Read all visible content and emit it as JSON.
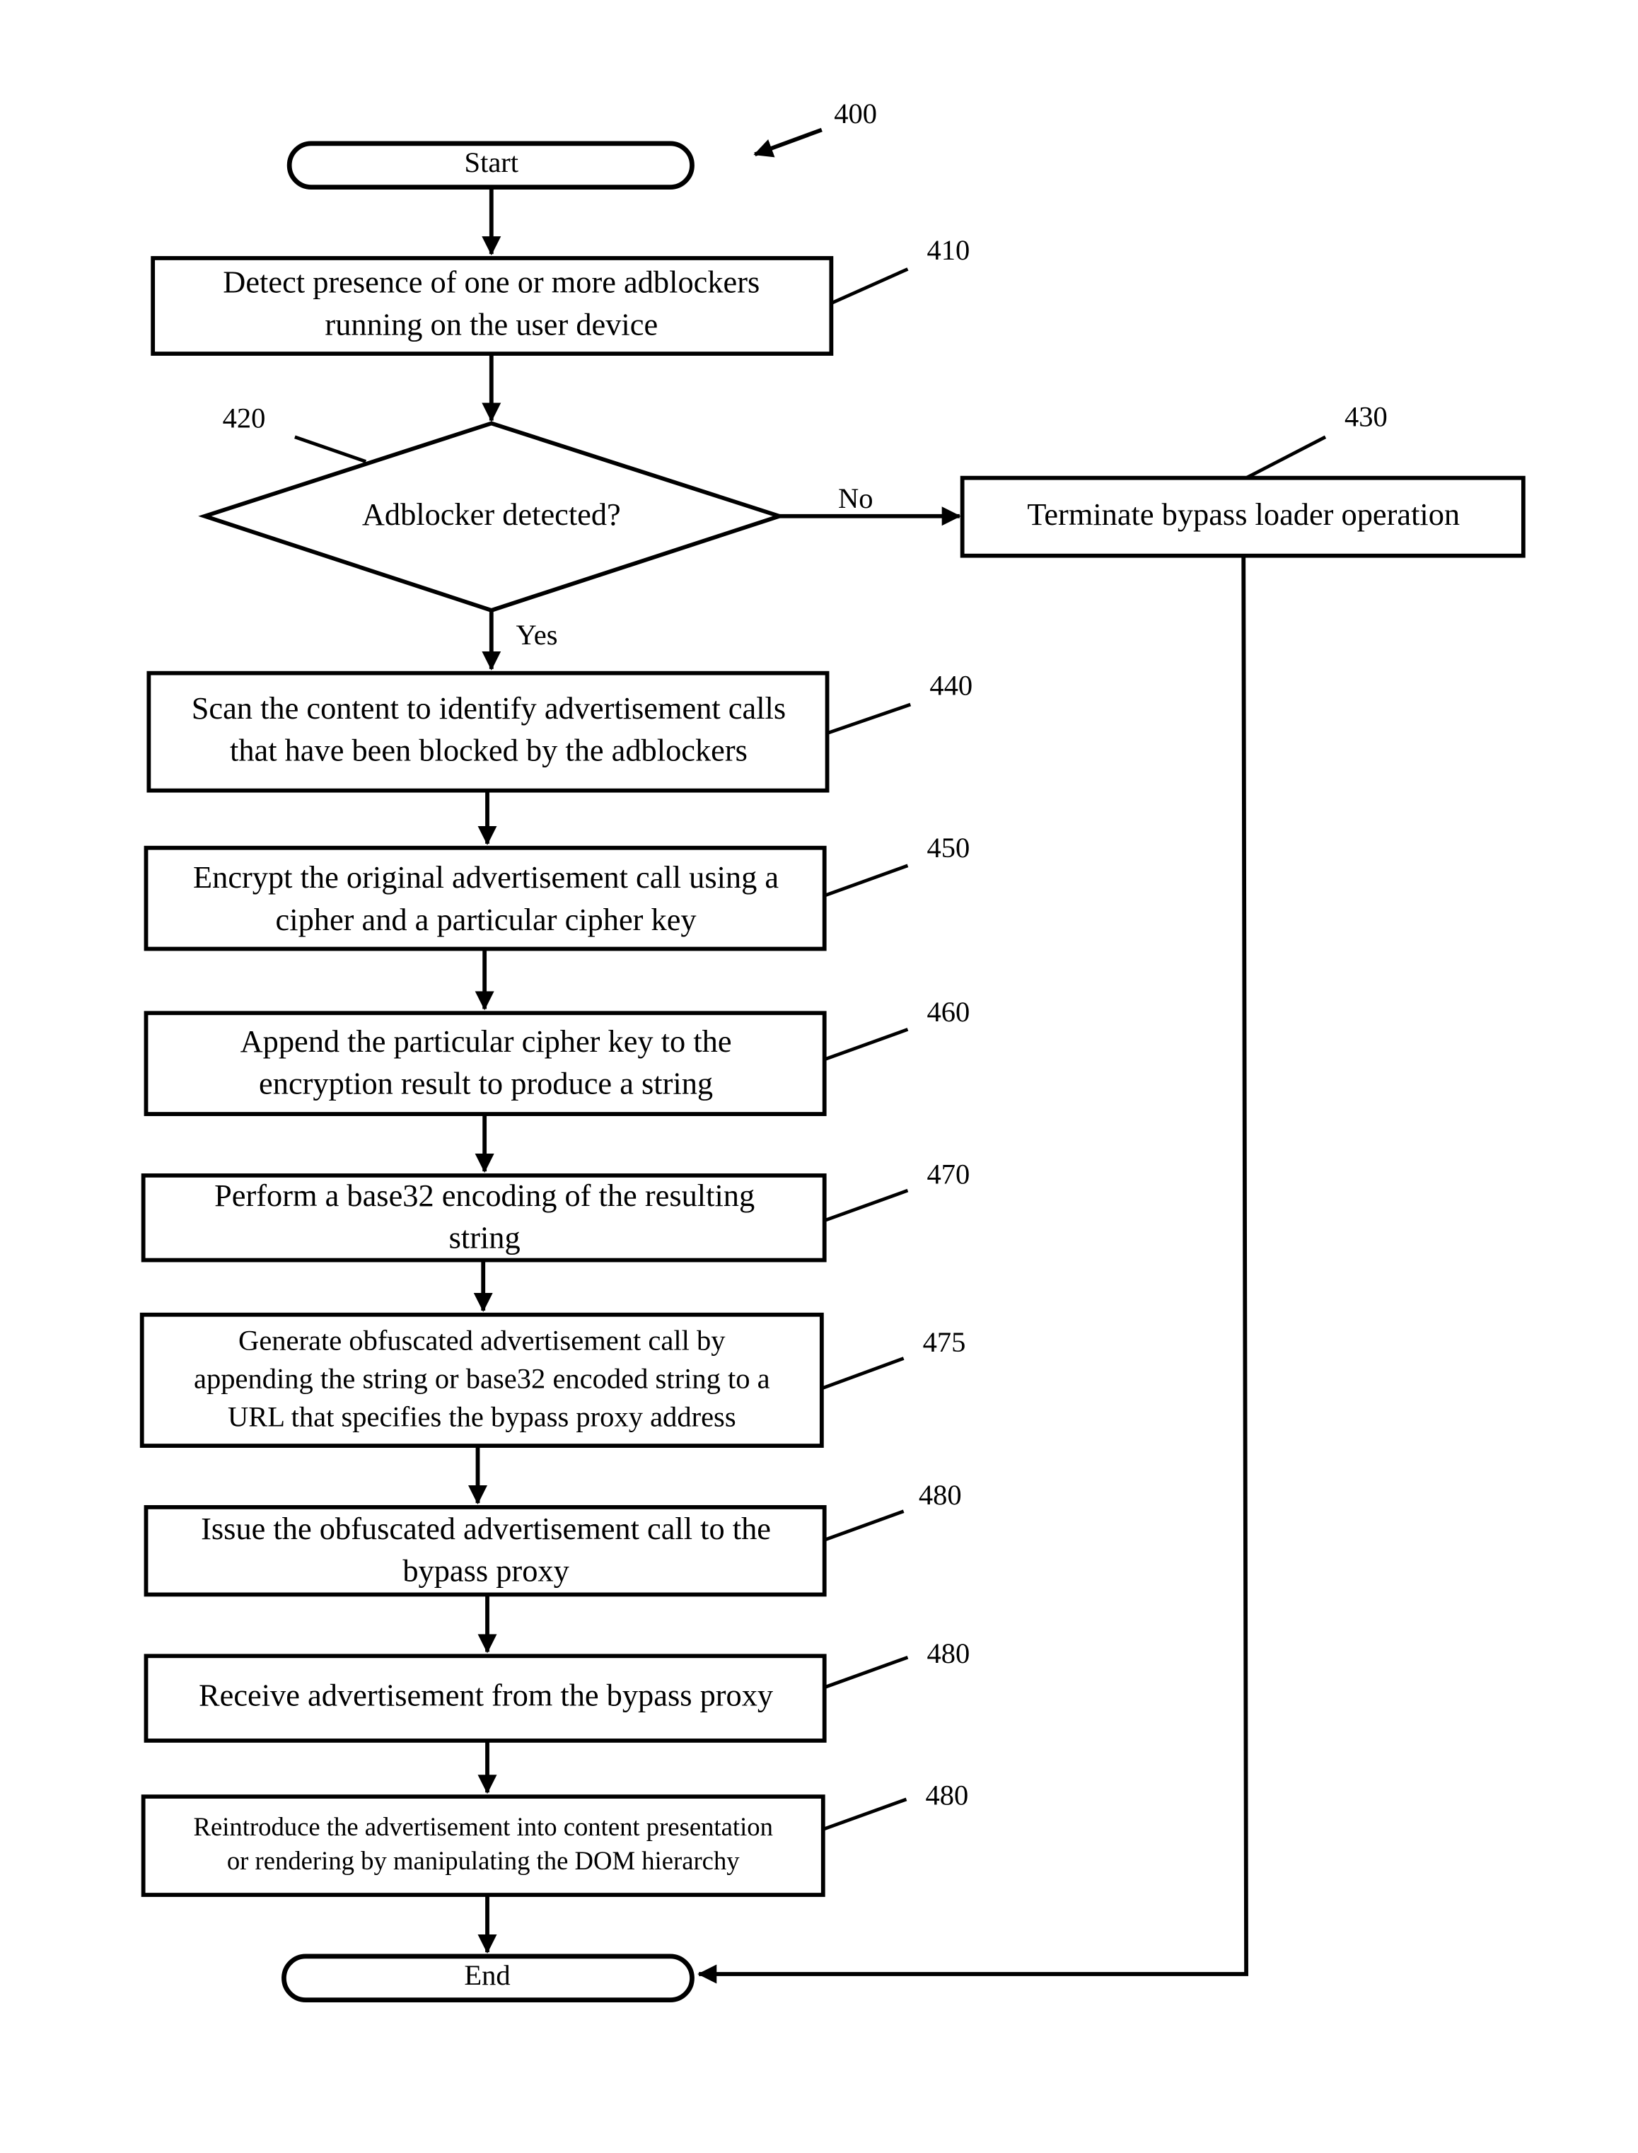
{
  "figure": {
    "number": "400",
    "start": "Start",
    "end": "End",
    "steps": [
      {
        "ref": "410",
        "lines": [
          "Detect presence of one or more adblockers",
          "running on the user device"
        ]
      },
      {
        "ref": "420",
        "lines": [
          "Adblocker detected?"
        ]
      },
      {
        "ref": "430",
        "lines": [
          "Terminate bypass loader operation"
        ]
      },
      {
        "ref": "440",
        "lines": [
          "Scan the content to identify advertisement calls",
          "that have been blocked by the adblockers"
        ]
      },
      {
        "ref": "450",
        "lines": [
          "Encrypt the original advertisement call using a",
          "cipher and a particular cipher key"
        ]
      },
      {
        "ref": "460",
        "lines": [
          "Append the particular cipher key to the",
          "encryption result to produce a string"
        ]
      },
      {
        "ref": "470",
        "lines": [
          "Perform a base32 encoding of the resulting",
          "string"
        ]
      },
      {
        "ref": "475",
        "lines": [
          "Generate obfuscated advertisement call by",
          "appending the string or base32 encoded string to a",
          "URL that specifies the bypass proxy address"
        ]
      },
      {
        "ref": "480",
        "lines": [
          "Issue the obfuscated advertisement call to the",
          "bypass proxy"
        ]
      },
      {
        "ref": "480",
        "lines": [
          "Receive advertisement from the bypass proxy"
        ]
      },
      {
        "ref": "480",
        "lines": [
          "Reintroduce the advertisement into content presentation",
          "or rendering by manipulating the DOM hierarchy"
        ]
      }
    ],
    "decision_labels": {
      "no": "No",
      "yes": "Yes"
    }
  }
}
